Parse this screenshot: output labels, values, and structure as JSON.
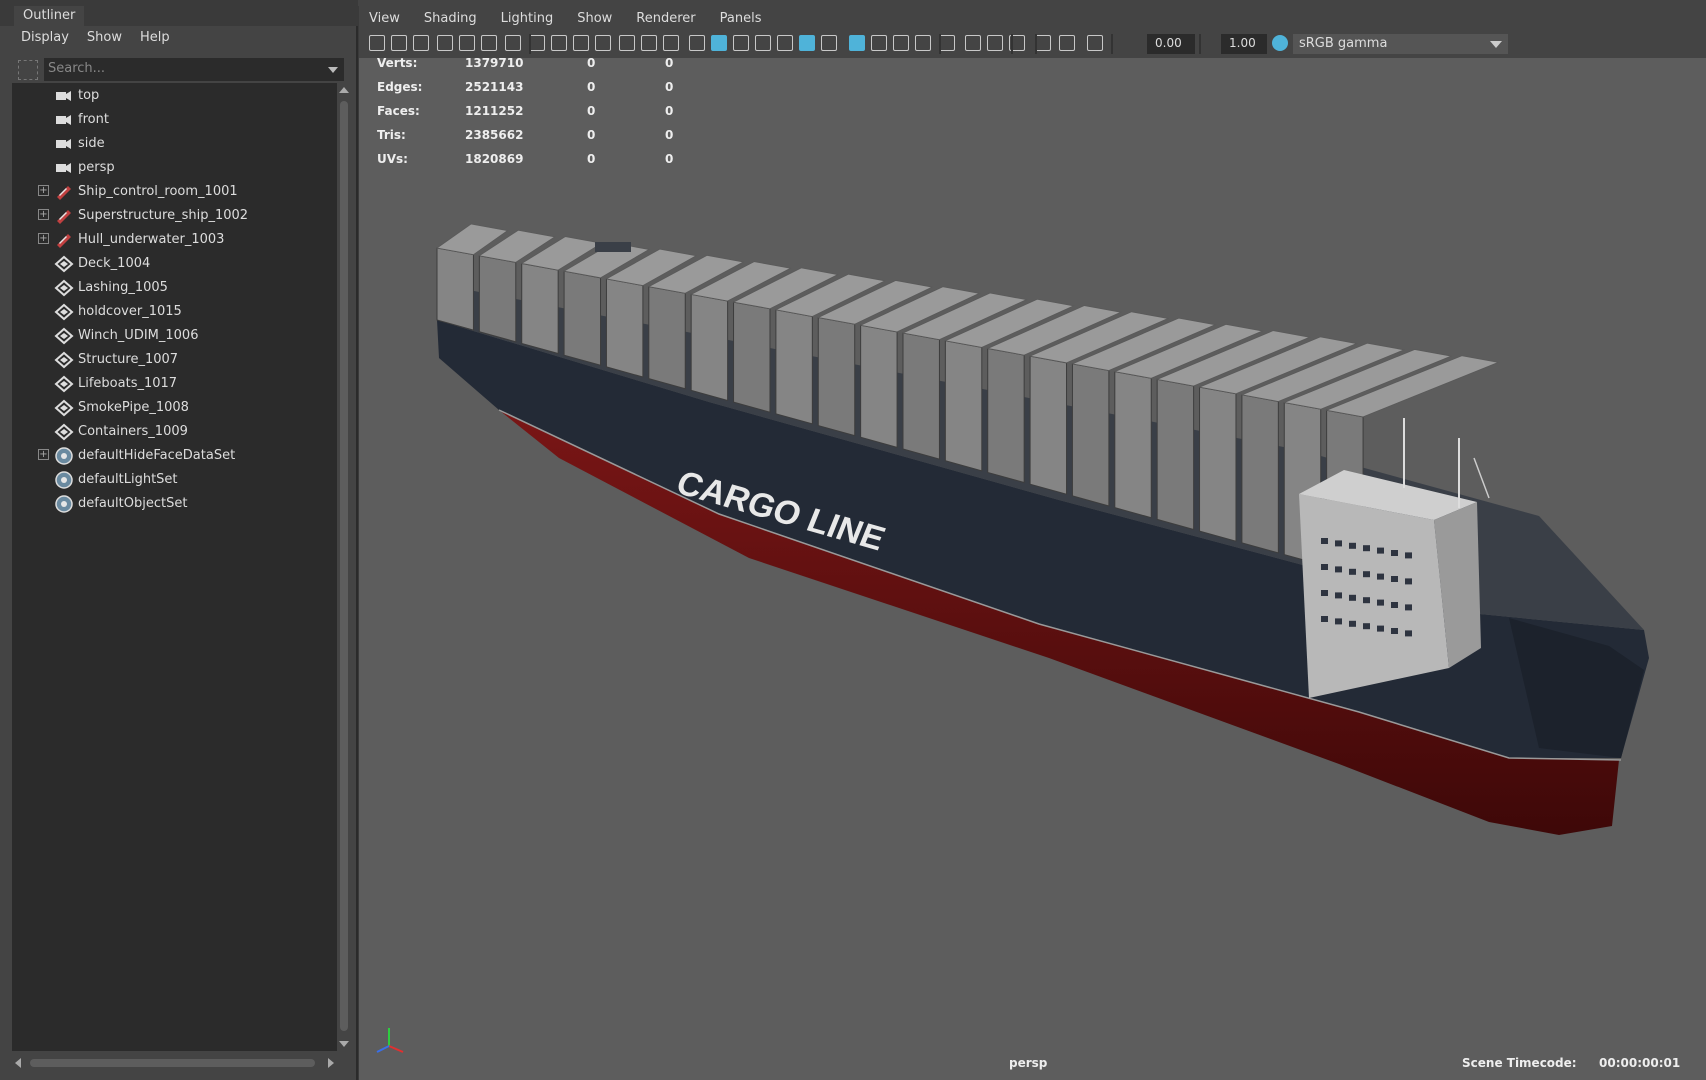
{
  "outliner": {
    "tab": "Outliner",
    "menu": [
      "Display",
      "Show",
      "Help"
    ],
    "search_placeholder": "Search...",
    "items": [
      {
        "label": "top",
        "icon": "camera-icon",
        "expandable": false
      },
      {
        "label": "front",
        "icon": "camera-icon",
        "expandable": false
      },
      {
        "label": "side",
        "icon": "camera-icon",
        "expandable": false
      },
      {
        "label": "persp",
        "icon": "camera-icon",
        "expandable": false
      },
      {
        "label": "Ship_control_room_1001",
        "icon": "group-icon",
        "expandable": true
      },
      {
        "label": "Superstructure_ship_1002",
        "icon": "group-icon",
        "expandable": true
      },
      {
        "label": "Hull_underwater_1003",
        "icon": "group-icon",
        "expandable": true
      },
      {
        "label": "Deck_1004",
        "icon": "mesh-icon",
        "expandable": false
      },
      {
        "label": "Lashing_1005",
        "icon": "mesh-icon",
        "expandable": false
      },
      {
        "label": "holdcover_1015",
        "icon": "mesh-icon",
        "expandable": false
      },
      {
        "label": "Winch_UDIM_1006",
        "icon": "mesh-icon",
        "expandable": false
      },
      {
        "label": "Structure_1007",
        "icon": "mesh-icon",
        "expandable": false
      },
      {
        "label": "Lifeboats_1017",
        "icon": "mesh-icon",
        "expandable": false
      },
      {
        "label": "SmokePipe_1008",
        "icon": "mesh-icon",
        "expandable": false
      },
      {
        "label": "Containers_1009",
        "icon": "mesh-icon",
        "expandable": false
      },
      {
        "label": "defaultHideFaceDataSet",
        "icon": "set-icon",
        "expandable": true
      },
      {
        "label": "defaultLightSet",
        "icon": "set-icon",
        "expandable": false
      },
      {
        "label": "defaultObjectSet",
        "icon": "set-icon",
        "expandable": false
      }
    ]
  },
  "viewport": {
    "menu": [
      "View",
      "Shading",
      "Lighting",
      "Show",
      "Renderer",
      "Panels"
    ],
    "toolbar": {
      "exposure": "0.00",
      "gamma": "1.00",
      "color_space": "sRGB gamma"
    },
    "hud": [
      {
        "label": "Verts:",
        "c1": "1379710",
        "c2": "0",
        "c3": "0"
      },
      {
        "label": "Edges:",
        "c1": "2521143",
        "c2": "0",
        "c3": "0"
      },
      {
        "label": "Faces:",
        "c1": "1211252",
        "c2": "0",
        "c3": "0"
      },
      {
        "label": "Tris:",
        "c1": "2385662",
        "c2": "0",
        "c3": "0"
      },
      {
        "label": "UVs:",
        "c1": "1820869",
        "c2": "0",
        "c3": "0"
      }
    ],
    "hull_text": "CARGO LINE",
    "camera": "persp",
    "timecode_label": "Scene Timecode:",
    "timecode_value": "00:00:00:01"
  },
  "colors": {
    "panel_bg": "#444444",
    "list_bg": "#2b2b2b",
    "viewport_bg": "#5d5d5d",
    "hull_dark": "#232a36",
    "hull_red": "#6d1414",
    "accent": "#4fb3d9"
  }
}
